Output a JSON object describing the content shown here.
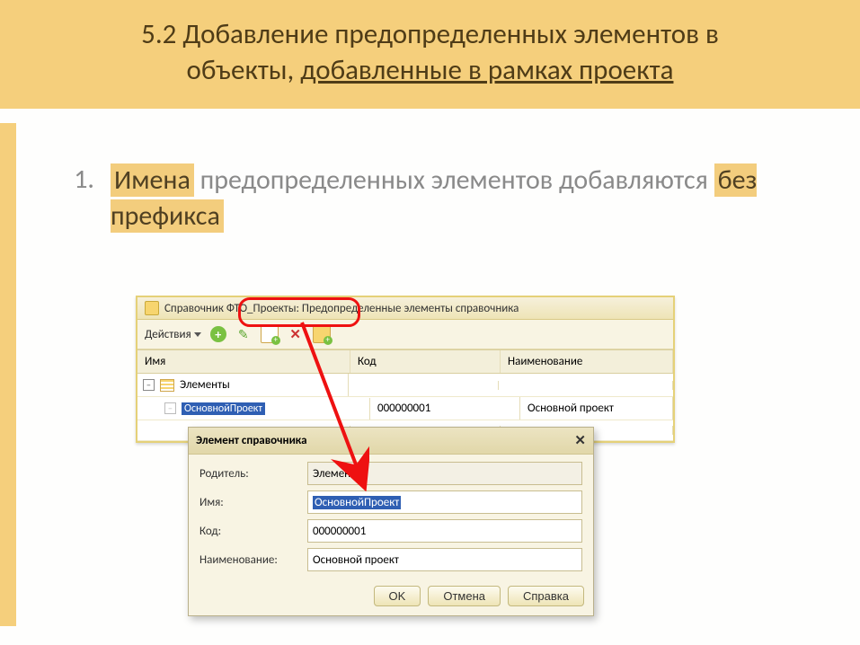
{
  "header": {
    "line1": "5.2 Добавление предопределенных элементов в",
    "line2_a": "объекты, ",
    "line2_u": "добавленные в рамках проекта"
  },
  "list": {
    "num": "1.",
    "hl1": "Имена",
    "t1": " предопределенных элементов добавляются ",
    "hl2": "без префикса"
  },
  "win": {
    "title_a": "Справочник ",
    "title_b": "ФТО_Проекты: ",
    "title_c": "Предопределенные элементы справочника",
    "actions": "Действия",
    "col_name": "Имя",
    "col_code": "Код",
    "col_title": "Наименование",
    "row_elements": "Элементы",
    "row_sel_name": "ОсновнойПроект",
    "row_sel_code": "000000001",
    "row_sel_title": "Основной проект"
  },
  "dialog": {
    "title": "Элемент справочника",
    "f_parent_l": "Родитель:",
    "f_parent_v": "Элементы",
    "f_name_l": "Имя:",
    "f_name_v": "ОсновнойПроект",
    "f_code_l": "Код:",
    "f_code_v": "000000001",
    "f_title_l": "Наименование:",
    "f_title_v": "Основной проект",
    "btn_ok": "OK",
    "btn_cancel": "Отмена",
    "btn_help": "Справка"
  }
}
